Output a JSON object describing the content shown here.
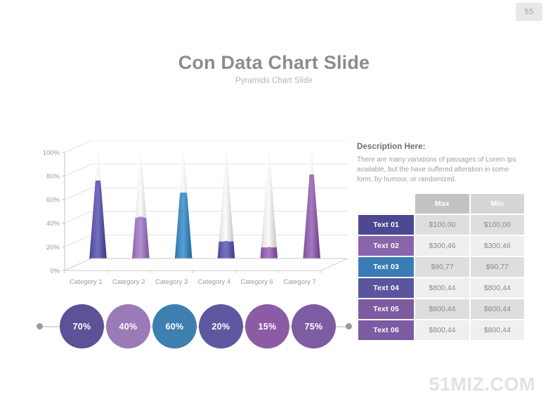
{
  "page": {
    "number": "55",
    "watermark": "51MIZ.COM"
  },
  "header": {
    "title": "Con Data Chart Slide",
    "subtitle": "Pyramids Chart Slide"
  },
  "description": {
    "heading": "Description Here:",
    "body": "There are many variations of passages  of Lorem Ips available, but the have suffered alteration in some form, by humour, or randomized."
  },
  "chart_data": {
    "type": "bar",
    "title": "Con Data Chart Slide",
    "subtitle": "Pyramids Chart Slide",
    "xlabel": "",
    "ylabel": "",
    "ylim": [
      0,
      100
    ],
    "ytick_labels": [
      "100%",
      "80%",
      "60%",
      "40%",
      "20%",
      "0%"
    ],
    "yticks": [
      100,
      80,
      60,
      40,
      20,
      0
    ],
    "grid": true,
    "legend": "none",
    "style": "3d-cone",
    "categories": [
      "Category 1",
      "Category 2",
      "Category 3",
      "Category 4",
      "Category 6",
      "Category 7"
    ],
    "values": [
      70,
      40,
      60,
      20,
      15,
      75
    ],
    "colors": [
      "#5b54a4",
      "#9a74b8",
      "#3d85b8",
      "#5d58a8",
      "#8f5fa8",
      "#8b5fa8"
    ],
    "unfilled_color": "#d2d2d2"
  },
  "circles": [
    {
      "label": "70%",
      "color": "#5b5298"
    },
    {
      "label": "40%",
      "color": "#9b7ab8"
    },
    {
      "label": "60%",
      "color": "#3d7fae"
    },
    {
      "label": "20%",
      "color": "#5d589f"
    },
    {
      "label": "15%",
      "color": "#8b5ba5"
    },
    {
      "label": "75%",
      "color": "#7e5ca3"
    }
  ],
  "table": {
    "headers": [
      "",
      "Max",
      "Min"
    ],
    "rows": [
      {
        "label": "Text 01",
        "color": "#4e4891",
        "max": "$100,00",
        "min": "$100,00"
      },
      {
        "label": "Text 02",
        "color": "#8a64ab",
        "max": "$300,46",
        "min": "$300,46"
      },
      {
        "label": "Text 03",
        "color": "#3a7cb4",
        "max": "$90,77",
        "min": "$90,77"
      },
      {
        "label": "Text 04",
        "color": "#5a559c",
        "max": "$800,44",
        "min": "$800,44"
      },
      {
        "label": "Text 05",
        "color": "#7e5aa0",
        "max": "$800,44",
        "min": "$800,44"
      },
      {
        "label": "Text 06",
        "color": "#7b5ba2",
        "max": "$800,44",
        "min": "$800,44"
      }
    ]
  }
}
